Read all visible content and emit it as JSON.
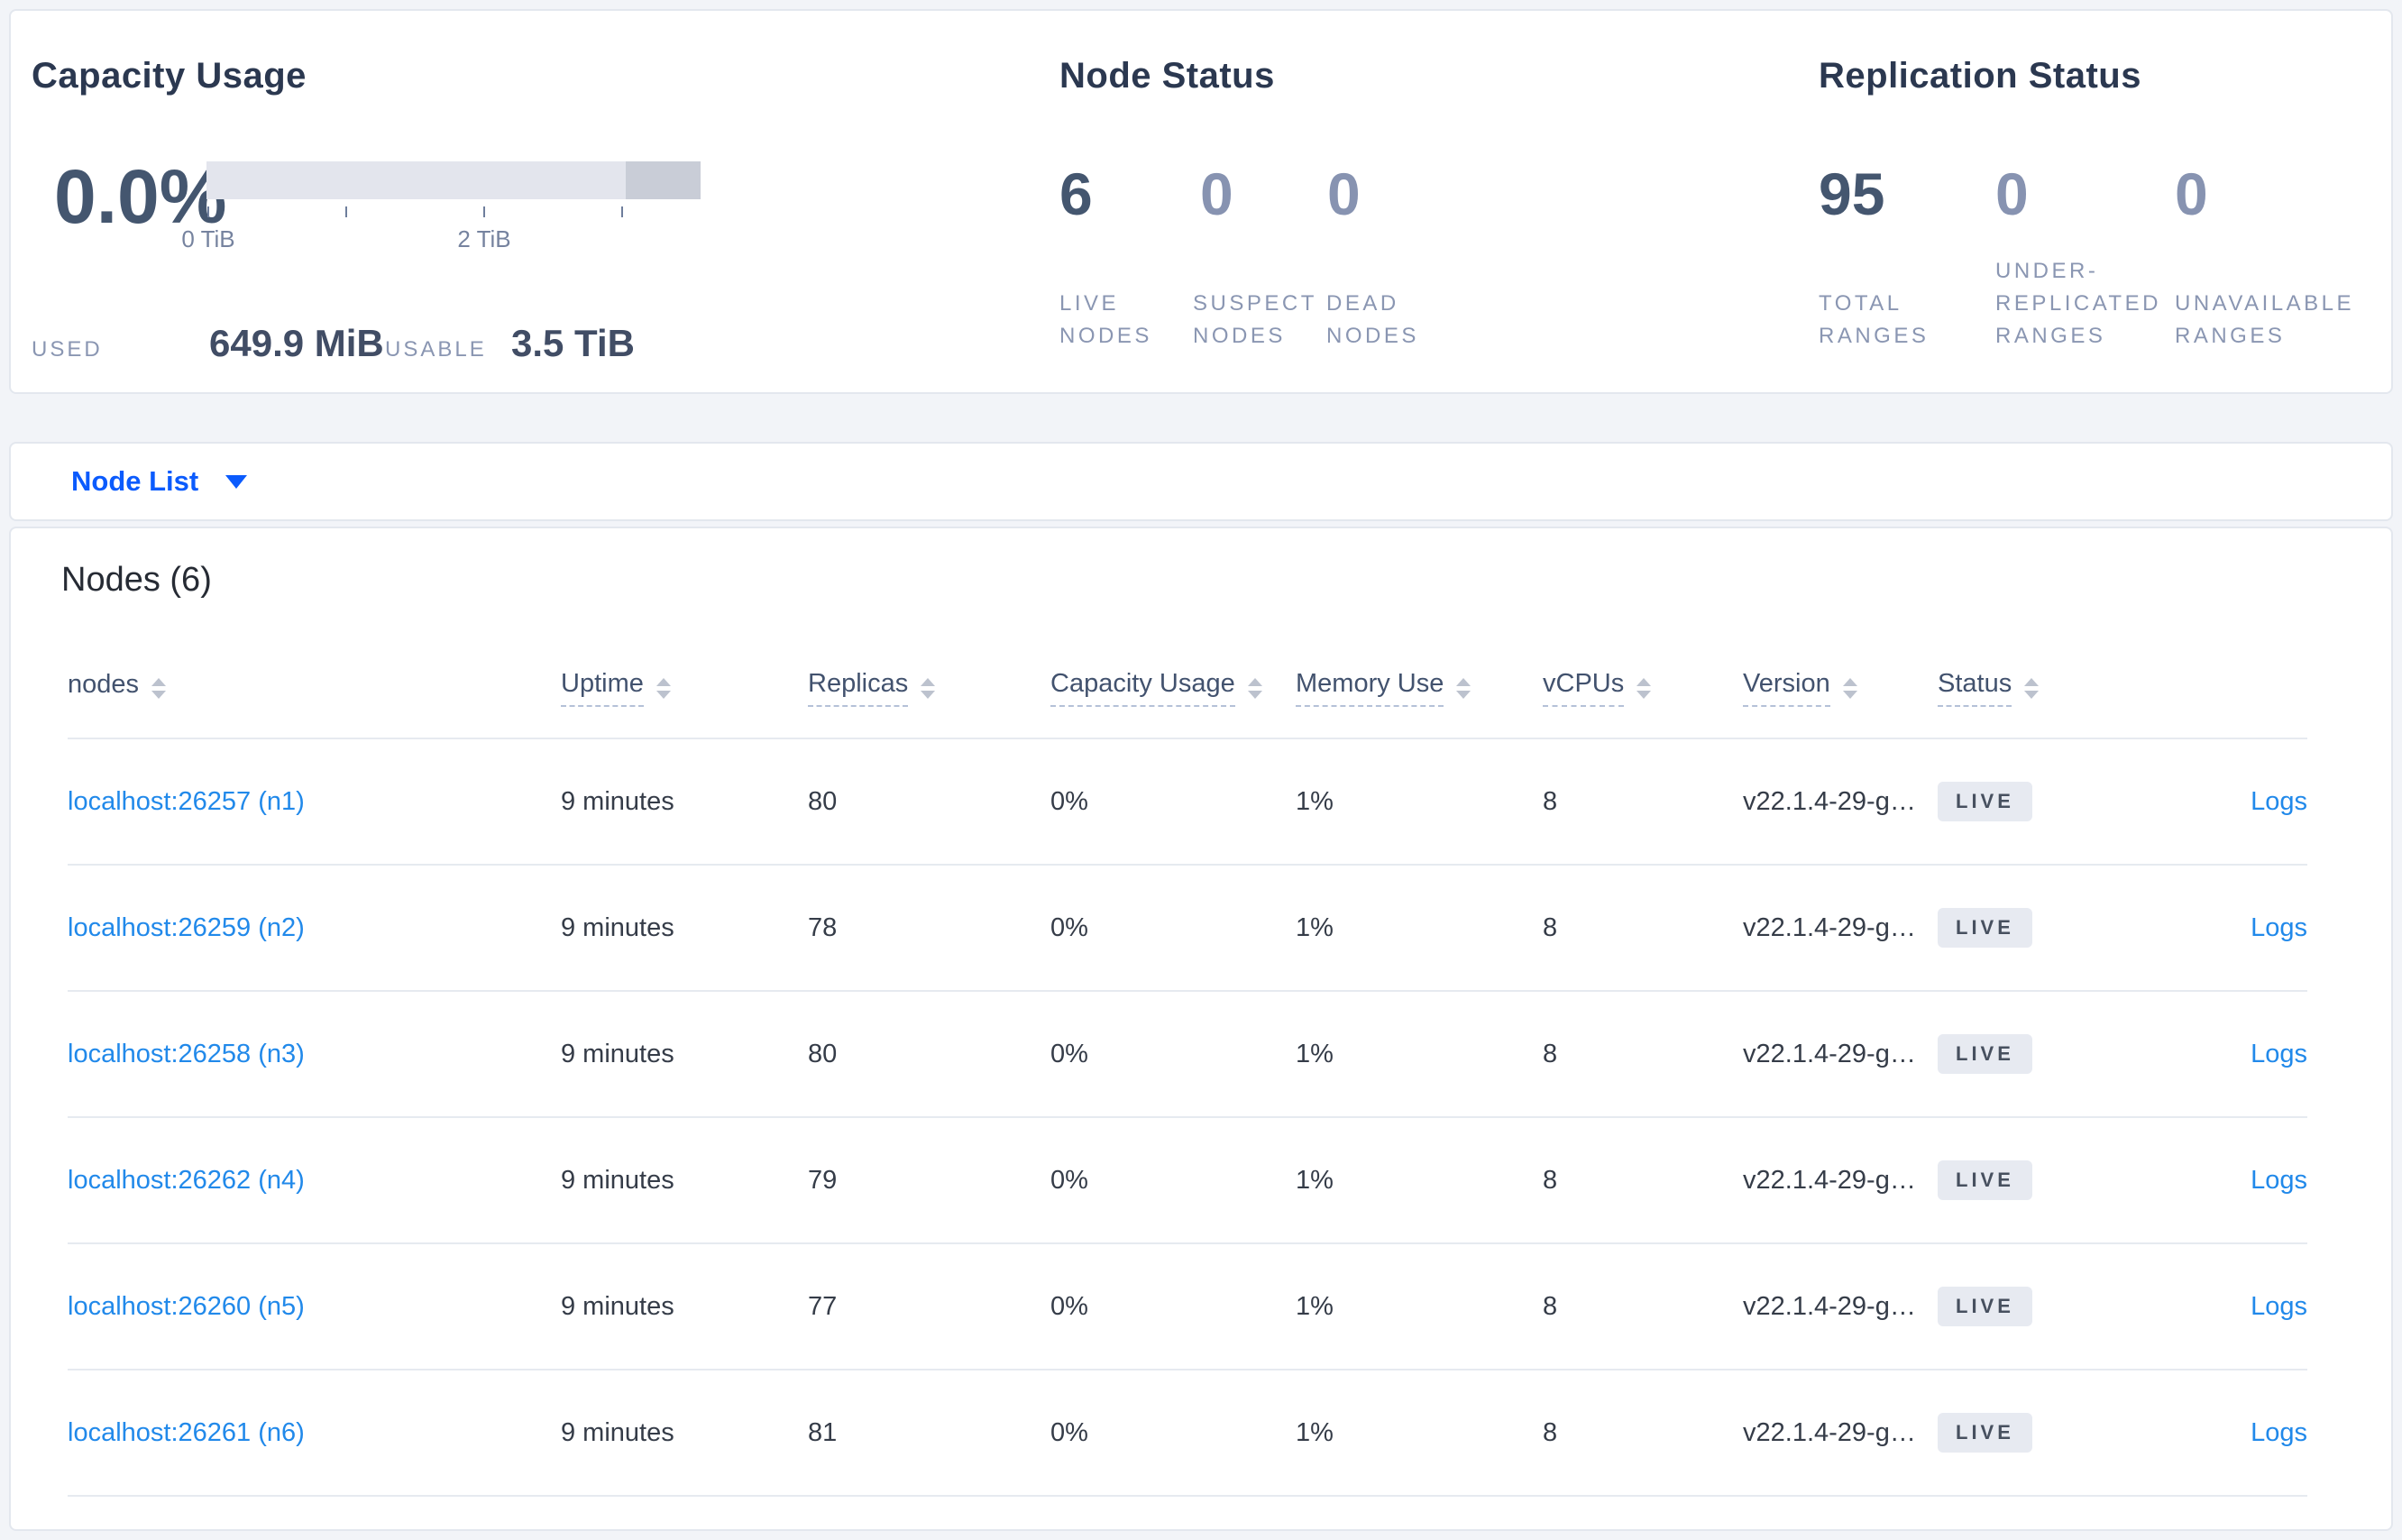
{
  "summary": {
    "capacity": {
      "title": "Capacity Usage",
      "percent": "0.0%",
      "tick_labels": [
        "0 TiB",
        "2 TiB"
      ],
      "used_label": "USED",
      "used_value": "649.9 MiB",
      "usable_label": "USABLE",
      "usable_value": "3.5 TiB"
    },
    "node_status": {
      "title": "Node Status",
      "stats": [
        {
          "value": "6",
          "label": "LIVE\nNODES"
        },
        {
          "value": "0",
          "label": "SUSPECT\nNODES"
        },
        {
          "value": "0",
          "label": "DEAD\nNODES"
        }
      ]
    },
    "replication_status": {
      "title": "Replication Status",
      "stats": [
        {
          "value": "95",
          "label": "TOTAL\nRANGES"
        },
        {
          "value": "0",
          "label": "UNDER-\nREPLICATED\nRANGES"
        },
        {
          "value": "0",
          "label": "UNAVAILABLE\nRANGES"
        }
      ]
    }
  },
  "node_list_dropdown": {
    "label": "Node List"
  },
  "nodes_table": {
    "title": "Nodes (6)",
    "columns": [
      "nodes",
      "Uptime",
      "Replicas",
      "Capacity Usage",
      "Memory Use",
      "vCPUs",
      "Version",
      "Status"
    ],
    "rows": [
      {
        "name": "localhost:26257 (n1)",
        "uptime": "9 minutes",
        "replicas": "80",
        "capacity": "0%",
        "memory": "1%",
        "vcpus": "8",
        "version": "v22.1.4-29-g…",
        "status": "LIVE",
        "logs": "Logs"
      },
      {
        "name": "localhost:26259 (n2)",
        "uptime": "9 minutes",
        "replicas": "78",
        "capacity": "0%",
        "memory": "1%",
        "vcpus": "8",
        "version": "v22.1.4-29-g…",
        "status": "LIVE",
        "logs": "Logs"
      },
      {
        "name": "localhost:26258 (n3)",
        "uptime": "9 minutes",
        "replicas": "80",
        "capacity": "0%",
        "memory": "1%",
        "vcpus": "8",
        "version": "v22.1.4-29-g…",
        "status": "LIVE",
        "logs": "Logs"
      },
      {
        "name": "localhost:26262 (n4)",
        "uptime": "9 minutes",
        "replicas": "79",
        "capacity": "0%",
        "memory": "1%",
        "vcpus": "8",
        "version": "v22.1.4-29-g…",
        "status": "LIVE",
        "logs": "Logs"
      },
      {
        "name": "localhost:26260 (n5)",
        "uptime": "9 minutes",
        "replicas": "77",
        "capacity": "0%",
        "memory": "1%",
        "vcpus": "8",
        "version": "v22.1.4-29-g…",
        "status": "LIVE",
        "logs": "Logs"
      },
      {
        "name": "localhost:26261 (n6)",
        "uptime": "9 minutes",
        "replicas": "81",
        "capacity": "0%",
        "memory": "1%",
        "vcpus": "8",
        "version": "v22.1.4-29-g…",
        "status": "LIVE",
        "logs": "Logs"
      }
    ]
  },
  "colors": {
    "accent_blue": "#0b5bfd",
    "link_blue": "#2189ea",
    "bar_track": "#e3e5ed",
    "bar_segment": "#c9cdd7",
    "badge_bg": "#e7eaf1"
  },
  "chart_data": {
    "type": "bar",
    "title": "Capacity Usage",
    "percent_used": 0.0,
    "used": "649.9 MiB",
    "usable": "3.5 TiB",
    "axis_unit": "TiB",
    "axis_ticks": [
      0,
      1,
      2,
      3
    ],
    "bar_extent_tib": 3.5
  }
}
